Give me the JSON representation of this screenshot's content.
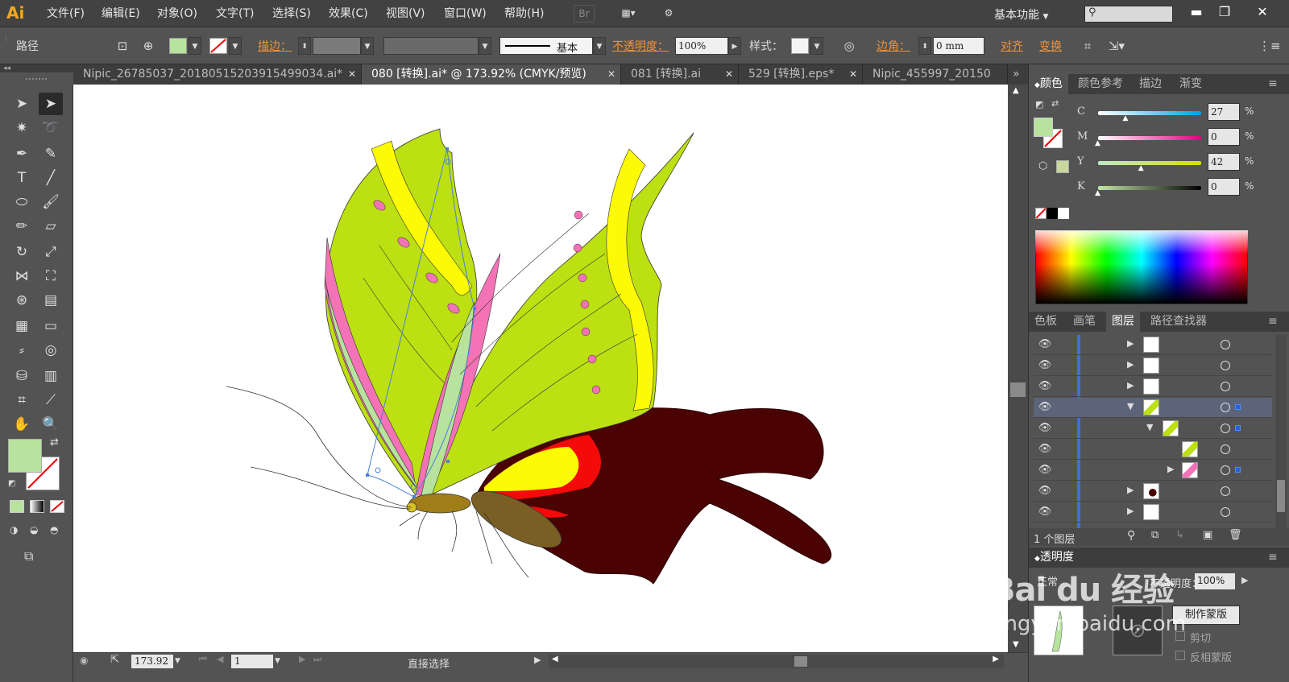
{
  "app": {
    "logo": "Ai"
  },
  "menu": [
    "文件(F)",
    "编辑(E)",
    "对象(O)",
    "文字(T)",
    "选择(S)",
    "效果(C)",
    "视图(V)",
    "窗口(W)",
    "帮助(H)"
  ],
  "menubar_buttons": {
    "bridge": "Br"
  },
  "workspace": {
    "label": "基本功能"
  },
  "window_controls": {
    "minimize": "▬",
    "restore": "❐",
    "close": "✕"
  },
  "control_bar": {
    "object_type": "路径",
    "fill_color": "#b7e39e",
    "stroke_label": "描边：",
    "stroke_style": "基本",
    "opacity_label": "不透明度：",
    "opacity_value": "100%",
    "style_label": "样式：",
    "corner_label": "边角：",
    "corner_value": "0 mm",
    "align_label": "对齐",
    "transform_label": "变换"
  },
  "tabs": [
    {
      "label": "Nipic_26785037_20180515203915499034.ai*",
      "active": false
    },
    {
      "label": "080 [转换].ai* @ 173.92% (CMYK/预览)",
      "active": true
    },
    {
      "label": "081 [转换].ai",
      "active": false
    },
    {
      "label": "529 [转换].eps*",
      "active": false
    },
    {
      "label": "Nipic_455997_20150",
      "active": false
    }
  ],
  "tab_overflow": "»",
  "color_panel": {
    "tabs": [
      "颜色",
      "颜色参考",
      "描边",
      "渐变"
    ],
    "channels": [
      {
        "name": "C",
        "value": "27",
        "level": 0.27,
        "gradient": "linear-gradient(90deg,#fff,#00a0e9)"
      },
      {
        "name": "M",
        "value": "0",
        "level": 0.0,
        "gradient": "linear-gradient(90deg,#fff,#e4007f)"
      },
      {
        "name": "Y",
        "value": "42",
        "level": 0.42,
        "gradient": "linear-gradient(90deg,#bfe9c8,#d6e000)"
      },
      {
        "name": "K",
        "value": "0",
        "level": 0.0,
        "gradient": "linear-gradient(90deg,#c5e8a8,#000)"
      }
    ],
    "percent": "%",
    "fill_color": "#b7e39e"
  },
  "layers_panel": {
    "tabs": [
      "色板",
      "画笔",
      "图层",
      "路径查找器"
    ],
    "footer": "1 个图层"
  },
  "transparency_panel": {
    "title": "透明度",
    "mode": "正常",
    "opacity_label": "不透明度：",
    "opacity_value": "100%",
    "make_mask": "制作蒙版",
    "clip": "剪切",
    "invert_mask": "反相蒙版"
  },
  "status_bar": {
    "zoom": "173.92",
    "artboard": "1",
    "tool": "直接选择"
  },
  "watermark": {
    "brand": "Bai du 经验",
    "url": "jingyan.baidu.com"
  },
  "colors": {
    "wing_green": "#bce011",
    "wing_yellow": "#fdfa05",
    "wing_pink": "#f472b6",
    "wing_light_green": "#b7e39e",
    "hindwing_dark": "#4a0202",
    "hindwing_red": "#f50a0a",
    "body_brown": "#a07d18",
    "abdomen_olive": "#7a5f25",
    "selection_blue": "#4a7fd9"
  }
}
